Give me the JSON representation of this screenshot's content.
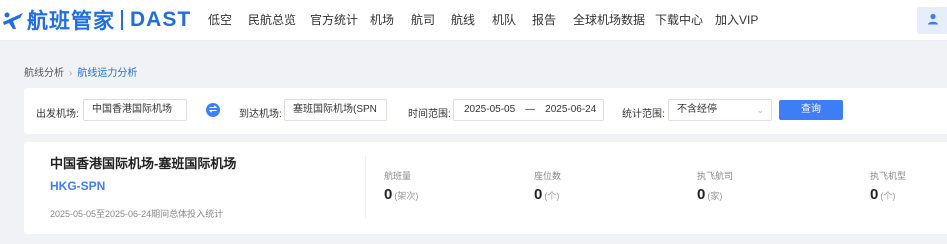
{
  "header": {
    "logo_cn": "航班管家",
    "logo_en": "DAST",
    "nav": [
      "低空",
      "民航总览",
      "官方统计",
      "机场",
      "航司",
      "航线",
      "机队",
      "报告",
      "全球机场数据",
      "下载中心",
      "加入VIP"
    ]
  },
  "breadcrumb": {
    "parent": "航线分析",
    "current": "航线运力分析"
  },
  "filter": {
    "departure_label": "出发机场:",
    "departure_value": "中国香港国际机场",
    "arrival_label": "到达机场:",
    "arrival_value": "塞班国际机场(SPN",
    "time_label": "时间范围:",
    "date_start": "2025-05-05",
    "date_sep": "—",
    "date_end": "2025-06-24",
    "scope_label": "统计范围:",
    "scope_value": "不含经停",
    "query_label": "查询"
  },
  "summary": {
    "route_title": "中国香港国际机场-塞班国际机场",
    "route_code": "HKG-SPN",
    "note": "2025-05-05至2025-06-24期间总体投入统计",
    "stats": [
      {
        "label": "航班量",
        "value": "0",
        "unit": "(架次)"
      },
      {
        "label": "座位数",
        "value": "0",
        "unit": "(个)"
      },
      {
        "label": "执飞航司",
        "value": "0",
        "unit": "(家)"
      },
      {
        "label": "执飞机型",
        "value": "0",
        "unit": "(个)"
      }
    ]
  },
  "colors": {
    "accent": "#1f6fe0",
    "button": "#3d7ef5"
  }
}
